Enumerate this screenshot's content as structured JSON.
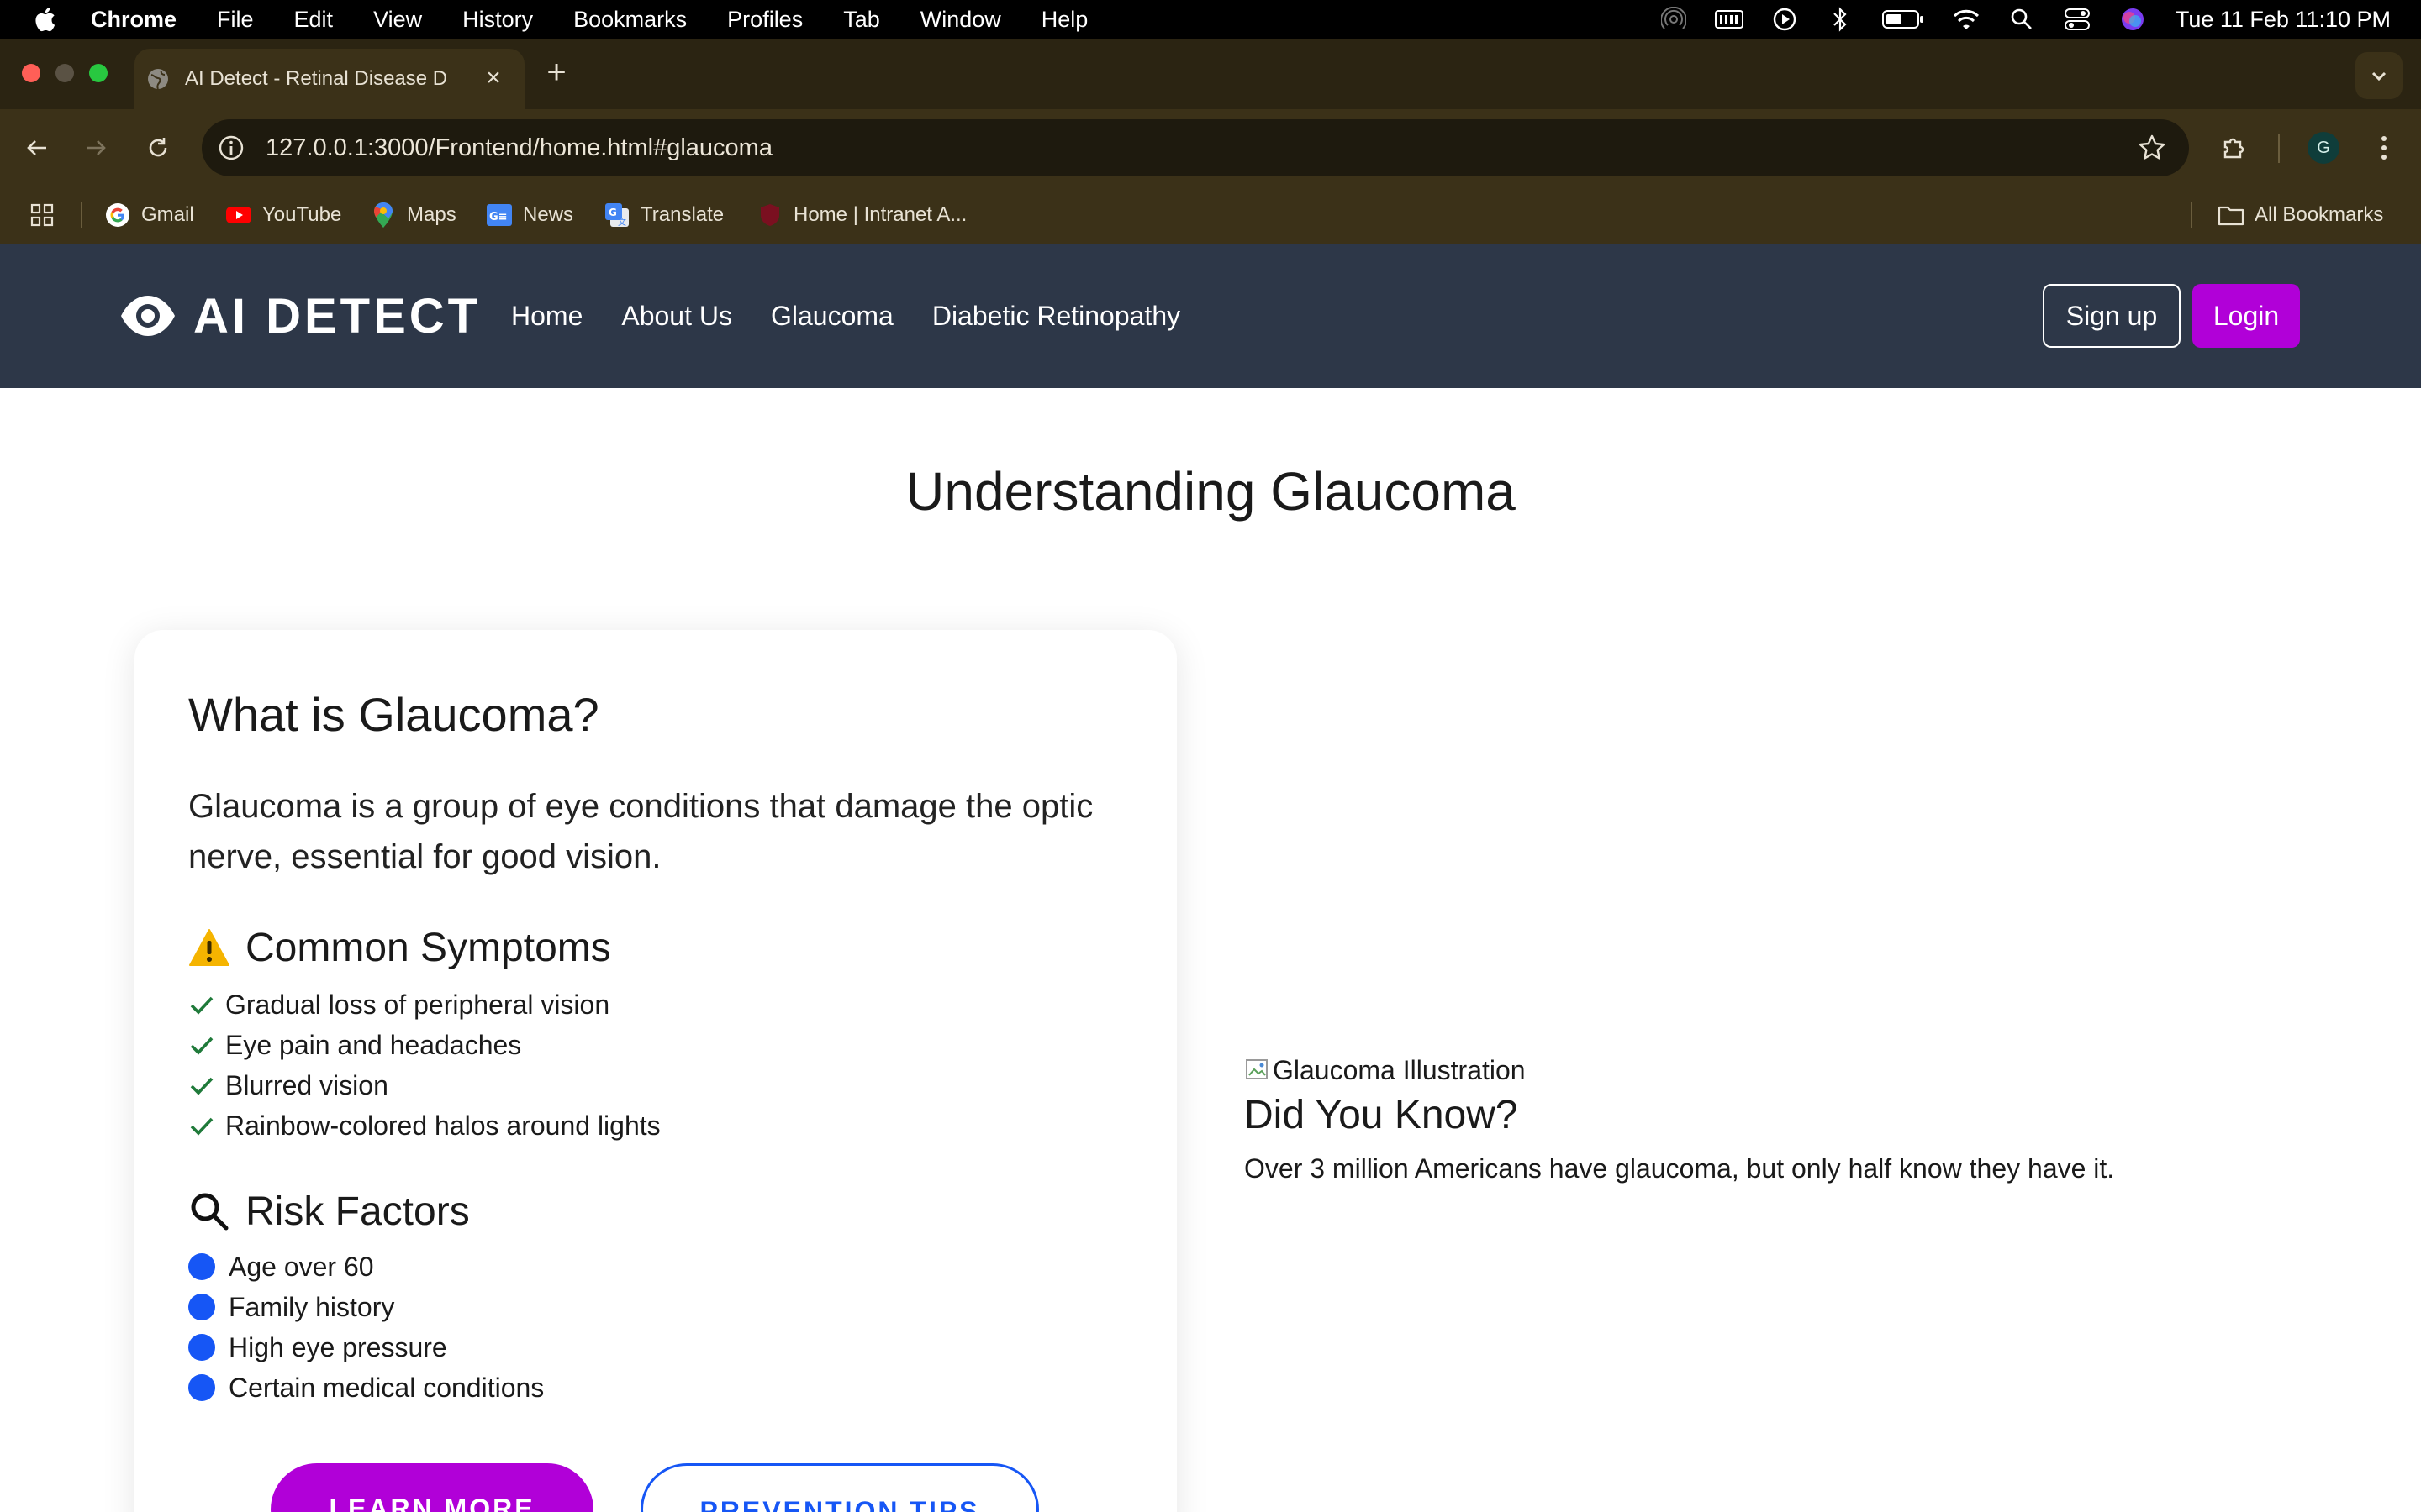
{
  "menubar": {
    "app_name": "Chrome",
    "items": [
      "File",
      "Edit",
      "View",
      "History",
      "Bookmarks",
      "Profiles",
      "Tab",
      "Window",
      "Help"
    ],
    "clock": "Tue 11 Feb  11:10 PM"
  },
  "browser": {
    "tab_title": "AI Detect - Retinal Disease D",
    "url": "127.0.0.1:3000/Frontend/home.html#glaucoma",
    "profile_initial": "G",
    "bookmarks": [
      "Gmail",
      "YouTube",
      "Maps",
      "News",
      "Translate",
      "Home | Intranet A..."
    ],
    "all_bookmarks": "All Bookmarks"
  },
  "site": {
    "brand": "AI DETECT",
    "nav": [
      "Home",
      "About Us",
      "Glaucoma",
      "Diabetic Retinopathy"
    ],
    "signup": "Sign up",
    "login": "Login"
  },
  "main": {
    "title": "Understanding Glaucoma",
    "card": {
      "heading": "What is Glaucoma?",
      "intro": "Glaucoma is a group of eye conditions that damage the optic nerve, essential for good vision.",
      "symptoms_heading": "Common Symptoms",
      "symptoms": [
        "Gradual loss of peripheral vision",
        "Eye pain and headaches",
        "Blurred vision",
        "Rainbow-colored halos around lights"
      ],
      "risk_heading": "Risk Factors",
      "risks": [
        "Age over 60",
        "Family history",
        "High eye pressure",
        "Certain medical conditions"
      ],
      "learn_more": "LEARN MORE",
      "prevention": "PREVENTION TIPS"
    },
    "aside": {
      "image_alt": "Glaucoma Illustration",
      "heading": "Did You Know?",
      "fact": "Over 3 million Americans have glaucoma, but only half know they have it."
    }
  },
  "colors": {
    "navbar": "#2d3748",
    "accent_purple": "#b100d8",
    "accent_blue": "#1656f5",
    "check_green": "#1f7a3a",
    "warning_yellow": "#f5b400"
  }
}
